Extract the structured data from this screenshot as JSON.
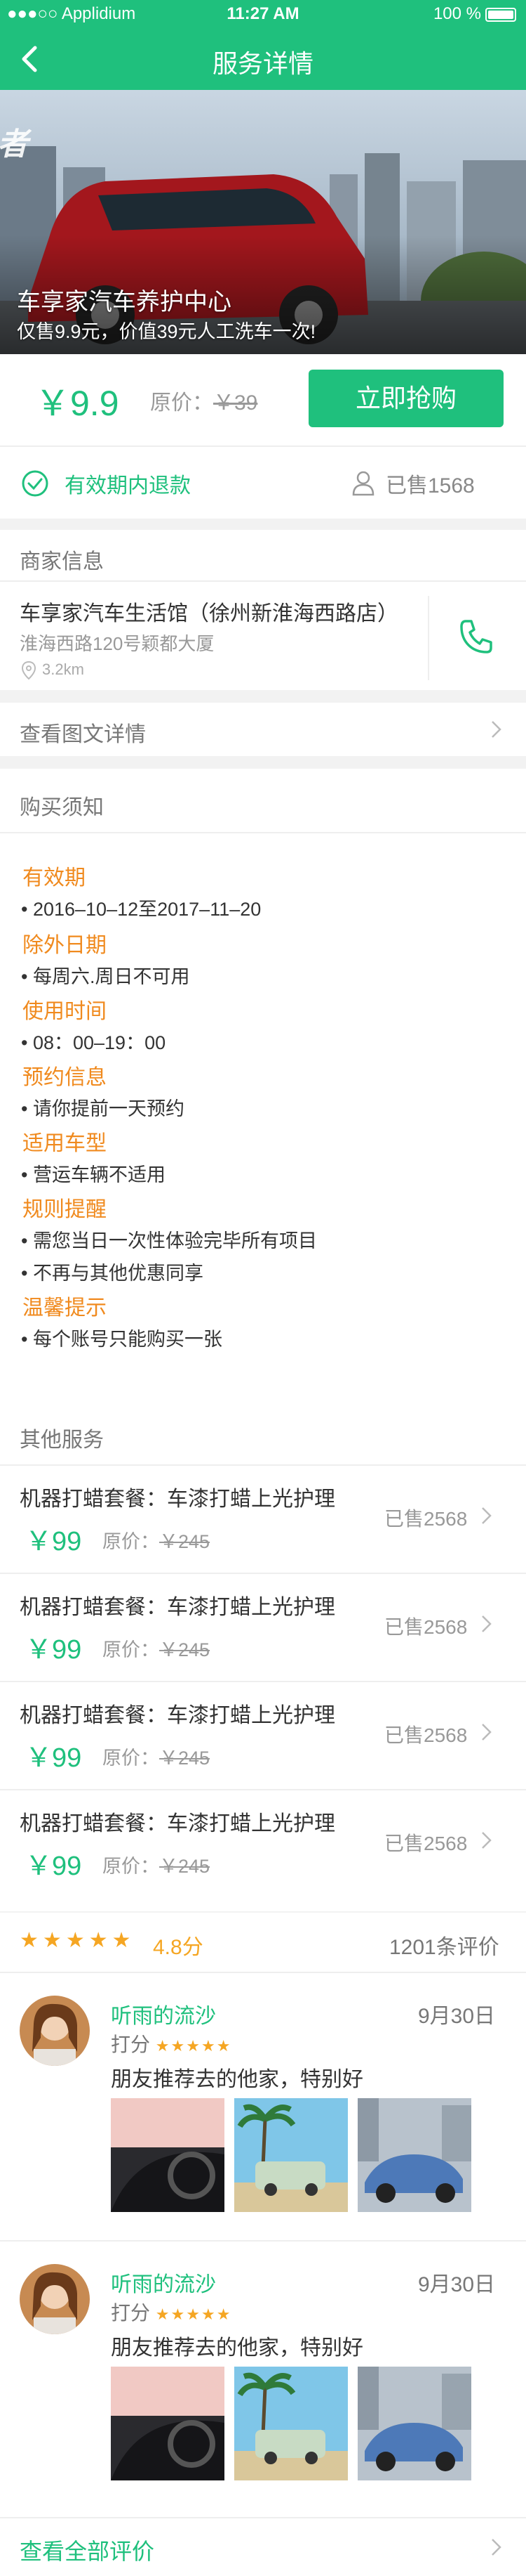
{
  "status_bar": {
    "carrier": "●●●○○ Applidium",
    "time": "11:27 AM",
    "battery": "100 %"
  },
  "nav": {
    "title": "服务详情"
  },
  "hero": {
    "title": "车享家汽车养护中心",
    "subtitle": "仅售9.9元，价值39元人工洗车一次!"
  },
  "purchase": {
    "price": "￥9.9",
    "original_label": "原价：",
    "original_price": "￥39",
    "buy_label": "立即抢购"
  },
  "guarantee": {
    "refund": "有效期内退款",
    "sold": "已售1568"
  },
  "merchant": {
    "section_title": "商家信息",
    "name": "车享家汽车生活馆（徐州新淮海西路店）",
    "address": "淮海西路120号颖都大厦",
    "distance": "3.2km"
  },
  "details_link": {
    "label": "查看图文详情"
  },
  "notice": {
    "section_title": "购买须知",
    "groups": [
      {
        "title": "有效期",
        "items": [
          "• 2016–10–12至2017–11–20"
        ]
      },
      {
        "title": "除外日期",
        "items": [
          "• 每周六.周日不可用"
        ]
      },
      {
        "title": "使用时间",
        "items": [
          "• 08：00–19：00"
        ]
      },
      {
        "title": "预约信息",
        "items": [
          "• 请你提前一天预约"
        ]
      },
      {
        "title": "适用车型",
        "items": [
          "• 营运车辆不适用"
        ]
      },
      {
        "title": "规则提醒",
        "items": [
          "• 需您当日一次性体验完毕所有项目",
          "• 不再与其他优惠同享"
        ]
      },
      {
        "title": "温馨提示",
        "items": [
          "• 每个账号只能购买一张"
        ]
      }
    ]
  },
  "other_services": {
    "section_title": "其他服务",
    "items": [
      {
        "name": "机器打蜡套餐：车漆打蜡上光护理",
        "price": "￥99",
        "original_label": "原价：",
        "original_price": "￥245",
        "sold": "已售2568"
      },
      {
        "name": "机器打蜡套餐：车漆打蜡上光护理",
        "price": "￥99",
        "original_label": "原价：",
        "original_price": "￥245",
        "sold": "已售2568"
      },
      {
        "name": "机器打蜡套餐：车漆打蜡上光护理",
        "price": "￥99",
        "original_label": "原价：",
        "original_price": "￥245",
        "sold": "已售2568"
      },
      {
        "name": "机器打蜡套餐：车漆打蜡上光护理",
        "price": "￥99",
        "original_label": "原价：",
        "original_price": "￥245",
        "sold": "已售2568"
      }
    ]
  },
  "rating": {
    "score": "4.8分",
    "stars": 5,
    "count": "1201条评价"
  },
  "reviews": [
    {
      "user": "听雨的流沙",
      "date": "9月30日",
      "score_label": "打分",
      "stars": 5,
      "text": "朋友推荐去的他家，特别好"
    },
    {
      "user": "听雨的流沙",
      "date": "9月30日",
      "score_label": "打分",
      "stars": 5,
      "text": "朋友推荐去的他家，特别好"
    }
  ],
  "all_reviews": {
    "label": "查看全部评价"
  },
  "colors": {
    "brand_green": "#1fc07d",
    "notice_orange": "#f08a1e",
    "star": "#f5a623"
  }
}
